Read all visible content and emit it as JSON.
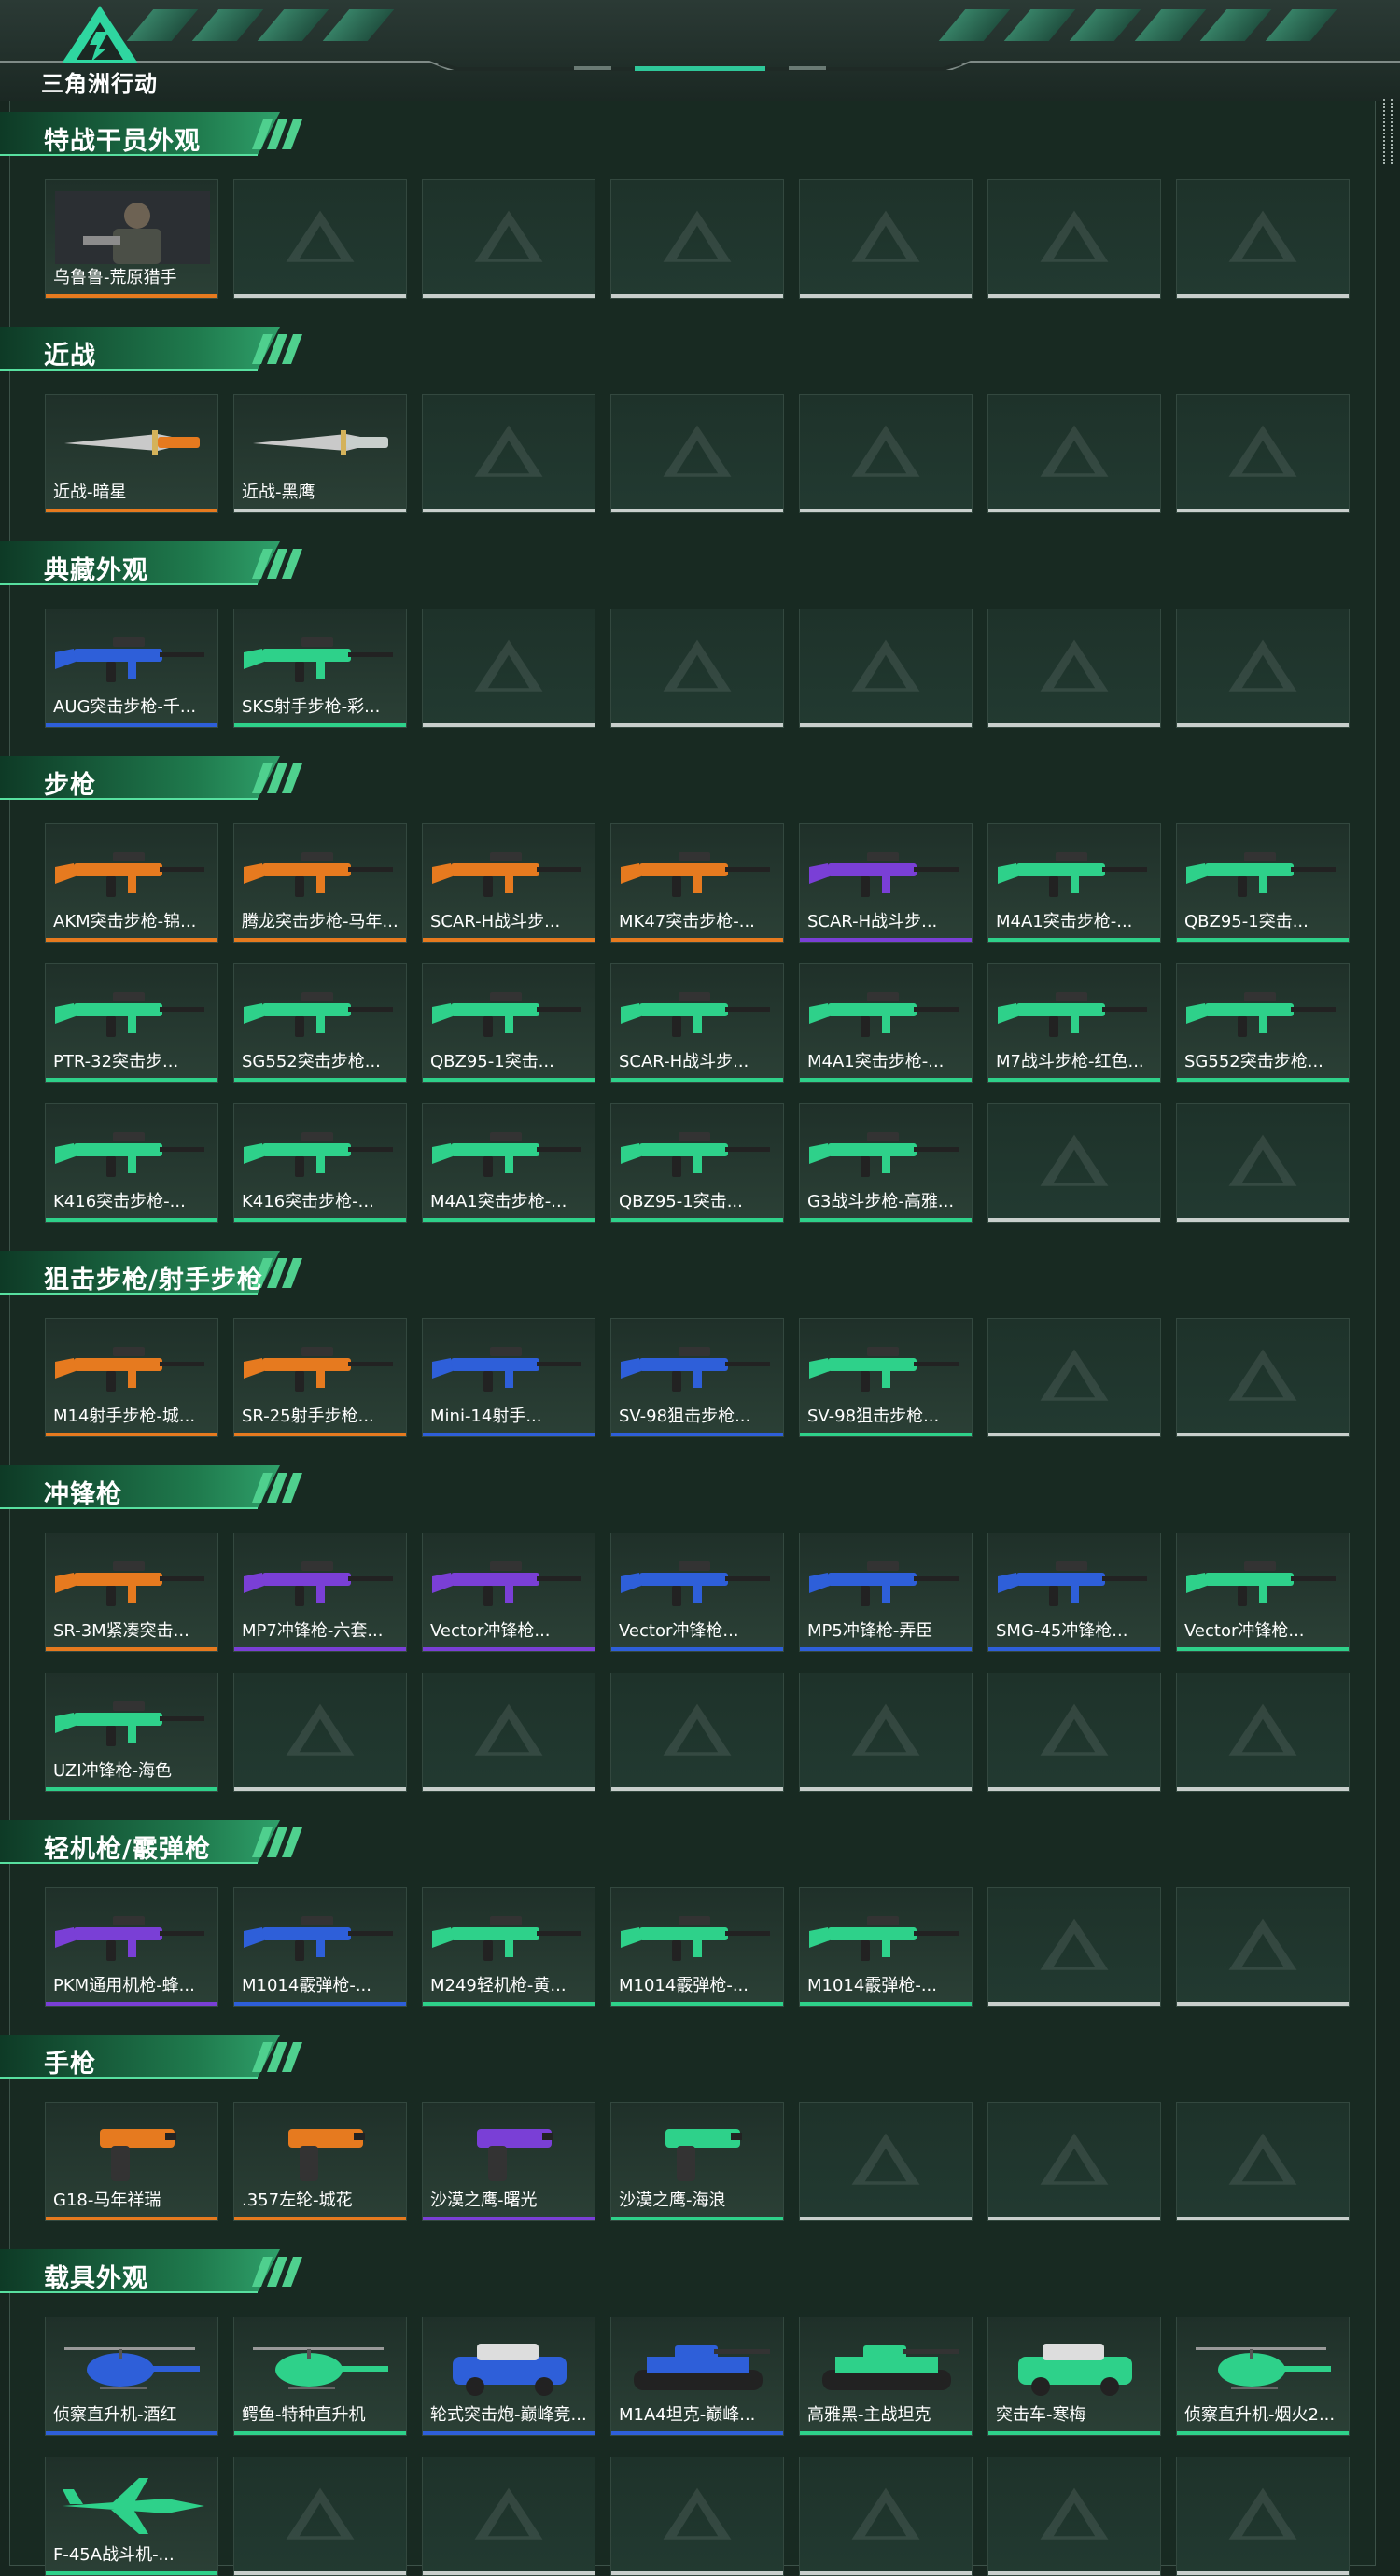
{
  "app": {
    "title": "三角洲行动"
  },
  "colors": {
    "gold": "#e67a1f",
    "purple": "#7a3fd6",
    "blue": "#2e5fd9",
    "green": "#2ed18a",
    "empty": "#c8cfcc"
  },
  "sections": [
    {
      "title": "特战干员外观",
      "items": [
        {
          "label": "乌鲁鲁-荒原猎手",
          "rarity": "gold",
          "kind": "operator"
        }
      ]
    },
    {
      "title": "近战",
      "items": [
        {
          "label": "近战-暗星",
          "rarity": "gold",
          "kind": "knife"
        },
        {
          "label": "近战-黑鹰",
          "rarity": "empty",
          "kind": "knife"
        }
      ]
    },
    {
      "title": "典藏外观",
      "items": [
        {
          "label": "AUG突击步枪-千...",
          "rarity": "blue",
          "kind": "rifle"
        },
        {
          "label": "SKS射手步枪-彩...",
          "rarity": "green",
          "kind": "rifle"
        }
      ]
    },
    {
      "title": "步枪",
      "items": [
        {
          "label": "AKM突击步枪-锦...",
          "rarity": "gold",
          "kind": "rifle"
        },
        {
          "label": "腾龙突击步枪-马年...",
          "rarity": "gold",
          "kind": "rifle"
        },
        {
          "label": "SCAR-H战斗步...",
          "rarity": "gold",
          "kind": "rifle"
        },
        {
          "label": "MK47突击步枪-...",
          "rarity": "gold",
          "kind": "rifle"
        },
        {
          "label": "SCAR-H战斗步...",
          "rarity": "purple",
          "kind": "rifle"
        },
        {
          "label": "M4A1突击步枪-...",
          "rarity": "green",
          "kind": "rifle"
        },
        {
          "label": "QBZ95-1突击...",
          "rarity": "green",
          "kind": "rifle"
        },
        {
          "label": "PTR-32突击步...",
          "rarity": "green",
          "kind": "rifle"
        },
        {
          "label": "SG552突击步枪...",
          "rarity": "green",
          "kind": "rifle"
        },
        {
          "label": "QBZ95-1突击...",
          "rarity": "green",
          "kind": "rifle"
        },
        {
          "label": "SCAR-H战斗步...",
          "rarity": "green",
          "kind": "rifle"
        },
        {
          "label": "M4A1突击步枪-...",
          "rarity": "green",
          "kind": "rifle"
        },
        {
          "label": "M7战斗步枪-红色...",
          "rarity": "green",
          "kind": "rifle"
        },
        {
          "label": "SG552突击步枪...",
          "rarity": "green",
          "kind": "rifle"
        },
        {
          "label": "K416突击步枪-...",
          "rarity": "green",
          "kind": "rifle"
        },
        {
          "label": "K416突击步枪-...",
          "rarity": "green",
          "kind": "rifle"
        },
        {
          "label": "M4A1突击步枪-...",
          "rarity": "green",
          "kind": "rifle"
        },
        {
          "label": "QBZ95-1突击...",
          "rarity": "green",
          "kind": "rifle"
        },
        {
          "label": "G3战斗步枪-高雅...",
          "rarity": "green",
          "kind": "rifle"
        }
      ]
    },
    {
      "title": "狙击步枪/射手步枪",
      "items": [
        {
          "label": "M14射手步枪-城...",
          "rarity": "gold",
          "kind": "rifle"
        },
        {
          "label": "SR-25射手步枪...",
          "rarity": "gold",
          "kind": "rifle"
        },
        {
          "label": "Mini-14射手...",
          "rarity": "blue",
          "kind": "rifle"
        },
        {
          "label": "SV-98狙击步枪...",
          "rarity": "blue",
          "kind": "rifle"
        },
        {
          "label": "SV-98狙击步枪...",
          "rarity": "green",
          "kind": "rifle"
        }
      ]
    },
    {
      "title": "冲锋枪",
      "items": [
        {
          "label": "SR-3M紧凑突击...",
          "rarity": "gold",
          "kind": "smg"
        },
        {
          "label": "MP7冲锋枪-六套...",
          "rarity": "purple",
          "kind": "smg"
        },
        {
          "label": "Vector冲锋枪...",
          "rarity": "purple",
          "kind": "smg"
        },
        {
          "label": "Vector冲锋枪...",
          "rarity": "blue",
          "kind": "smg"
        },
        {
          "label": "MP5冲锋枪-弄臣",
          "rarity": "blue",
          "kind": "smg"
        },
        {
          "label": "SMG-45冲锋枪...",
          "rarity": "blue",
          "kind": "smg"
        },
        {
          "label": "Vector冲锋枪...",
          "rarity": "green",
          "kind": "smg"
        },
        {
          "label": "UZI冲锋枪-海色",
          "rarity": "green",
          "kind": "smg"
        }
      ]
    },
    {
      "title": "轻机枪/霰弹枪",
      "items": [
        {
          "label": "PKM通用机枪-蜂...",
          "rarity": "purple",
          "kind": "rifle"
        },
        {
          "label": "M1014霰弹枪-...",
          "rarity": "blue",
          "kind": "shotgun"
        },
        {
          "label": "M249轻机枪-黄...",
          "rarity": "green",
          "kind": "rifle"
        },
        {
          "label": "M1014霰弹枪-...",
          "rarity": "green",
          "kind": "shotgun"
        },
        {
          "label": "M1014霰弹枪-...",
          "rarity": "green",
          "kind": "shotgun"
        }
      ]
    },
    {
      "title": "手枪",
      "items": [
        {
          "label": "G18-马年祥瑞",
          "rarity": "gold",
          "kind": "pistol"
        },
        {
          "label": ".357左轮-城花",
          "rarity": "gold",
          "kind": "pistol"
        },
        {
          "label": "沙漠之鹰-曙光",
          "rarity": "purple",
          "kind": "pistol"
        },
        {
          "label": "沙漠之鹰-海浪",
          "rarity": "green",
          "kind": "pistol"
        }
      ]
    },
    {
      "title": "载具外观",
      "items": [
        {
          "label": "侦察直升机-酒红",
          "rarity": "blue",
          "kind": "heli"
        },
        {
          "label": "鳄鱼-特种直升机",
          "rarity": "green",
          "kind": "heli"
        },
        {
          "label": "轮式突击炮-巅峰竞...",
          "rarity": "blue",
          "kind": "car"
        },
        {
          "label": "M1A4坦克-巅峰...",
          "rarity": "blue",
          "kind": "tank"
        },
        {
          "label": "高雅黑-主战坦克",
          "rarity": "green",
          "kind": "tank"
        },
        {
          "label": "突击车-寒梅",
          "rarity": "green",
          "kind": "car"
        },
        {
          "label": "侦察直升机-烟火2...",
          "rarity": "green",
          "kind": "heli"
        },
        {
          "label": "F-45A战斗机-...",
          "rarity": "green",
          "kind": "jet"
        }
      ]
    }
  ]
}
